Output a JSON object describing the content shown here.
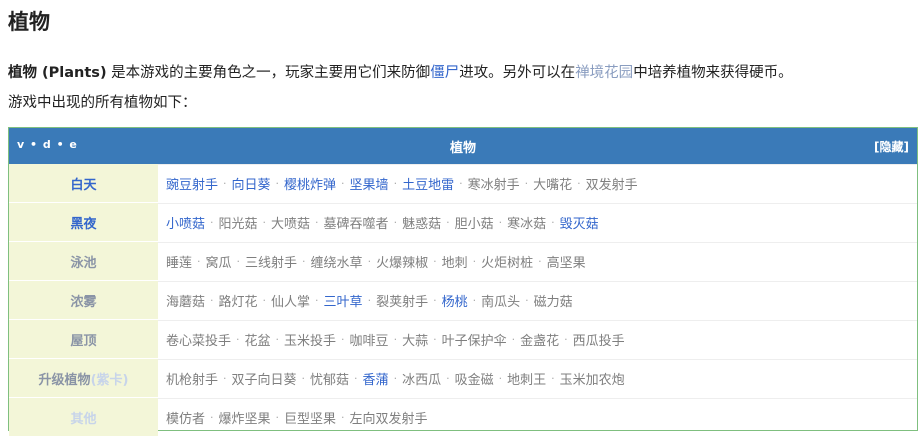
{
  "page": {
    "title": "植物"
  },
  "intro": {
    "bold_term": "植物 (Plants)",
    "text1": " 是本游戏的主要角色之一，玩家主要用它们来防御",
    "link_zombies": "僵尸",
    "text2": "进攻。另外可以在",
    "link_garden": "禅境花园",
    "text3": "中培养植物来获得硬币。",
    "line2": "游戏中出现的所有植物如下："
  },
  "navbox": {
    "vde": "v • d • e",
    "title": "植物",
    "hide_label": "[隐藏]",
    "separator": "·",
    "groups": [
      {
        "name": "白天",
        "name_style": "blue",
        "items": [
          {
            "label": "豌豆射手",
            "style": "blue"
          },
          {
            "label": "向日葵",
            "style": "blue"
          },
          {
            "label": "樱桃炸弹",
            "style": "blue"
          },
          {
            "label": "坚果墙",
            "style": "blue"
          },
          {
            "label": "土豆地雷",
            "style": "blue"
          },
          {
            "label": "寒冰射手",
            "style": "gray"
          },
          {
            "label": "大嘴花",
            "style": "gray"
          },
          {
            "label": "双发射手",
            "style": "gray"
          }
        ]
      },
      {
        "name": "黑夜",
        "name_style": "blue",
        "items": [
          {
            "label": "小喷菇",
            "style": "blue"
          },
          {
            "label": "阳光菇",
            "style": "gray"
          },
          {
            "label": "大喷菇",
            "style": "gray"
          },
          {
            "label": "墓碑吞噬者",
            "style": "gray"
          },
          {
            "label": "魅惑菇",
            "style": "gray"
          },
          {
            "label": "胆小菇",
            "style": "gray"
          },
          {
            "label": "寒冰菇",
            "style": "gray"
          },
          {
            "label": "毁灭菇",
            "style": "blue"
          }
        ]
      },
      {
        "name": "泳池",
        "name_style": "gray",
        "items": [
          {
            "label": "睡莲",
            "style": "gray"
          },
          {
            "label": "窝瓜",
            "style": "gray"
          },
          {
            "label": "三线射手",
            "style": "gray"
          },
          {
            "label": "缠绕水草",
            "style": "gray"
          },
          {
            "label": "火爆辣椒",
            "style": "gray"
          },
          {
            "label": "地刺",
            "style": "gray"
          },
          {
            "label": "火炬树桩",
            "style": "gray"
          },
          {
            "label": "高坚果",
            "style": "gray"
          }
        ]
      },
      {
        "name": "浓雾",
        "name_style": "gray",
        "items": [
          {
            "label": "海蘑菇",
            "style": "gray"
          },
          {
            "label": "路灯花",
            "style": "gray"
          },
          {
            "label": "仙人掌",
            "style": "gray"
          },
          {
            "label": "三叶草",
            "style": "blue"
          },
          {
            "label": "裂荚射手",
            "style": "gray"
          },
          {
            "label": "杨桃",
            "style": "blue"
          },
          {
            "label": "南瓜头",
            "style": "gray"
          },
          {
            "label": "磁力菇",
            "style": "gray"
          }
        ]
      },
      {
        "name": "屋顶",
        "name_style": "gray",
        "items": [
          {
            "label": "卷心菜投手",
            "style": "gray"
          },
          {
            "label": "花盆",
            "style": "gray"
          },
          {
            "label": "玉米投手",
            "style": "gray"
          },
          {
            "label": "咖啡豆",
            "style": "gray"
          },
          {
            "label": "大蒜",
            "style": "gray"
          },
          {
            "label": "叶子保护伞",
            "style": "gray"
          },
          {
            "label": "金盏花",
            "style": "gray"
          },
          {
            "label": "西瓜投手",
            "style": "gray"
          }
        ]
      },
      {
        "name": "升级植物",
        "name_sub": "(紫卡)",
        "name_style": "gray",
        "items": [
          {
            "label": "机枪射手",
            "style": "gray"
          },
          {
            "label": "双子向日葵",
            "style": "gray"
          },
          {
            "label": "忧郁菇",
            "style": "gray"
          },
          {
            "label": "香蒲",
            "style": "blue"
          },
          {
            "label": "冰西瓜",
            "style": "gray"
          },
          {
            "label": "吸金磁",
            "style": "gray"
          },
          {
            "label": "地刺王",
            "style": "gray"
          },
          {
            "label": "玉米加农炮",
            "style": "gray"
          }
        ]
      },
      {
        "name": "其他",
        "name_style": "faint",
        "items": [
          {
            "label": "模仿者",
            "style": "gray"
          },
          {
            "label": "爆炸坚果",
            "style": "gray"
          },
          {
            "label": "巨型坚果",
            "style": "gray"
          },
          {
            "label": "左向双发射手",
            "style": "gray"
          }
        ]
      }
    ]
  }
}
